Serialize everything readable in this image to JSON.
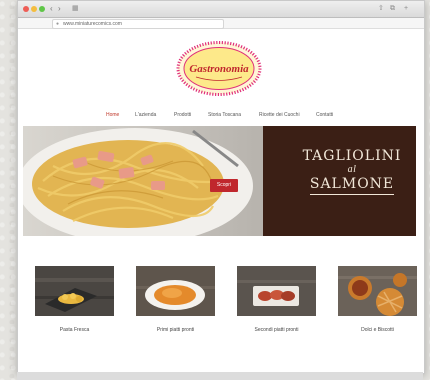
{
  "browser": {
    "url": "www.miniaturecomics.com",
    "back_icon": "chevron-left-icon",
    "forward_icon": "chevron-right-icon"
  },
  "site": {
    "logo_text": "Gastronomia",
    "menu": [
      "Home",
      "L'azienda",
      "Prodotti",
      "Storia Toscana",
      "Ricette dei Cuochi",
      "Contatti"
    ],
    "active_menu": "Home"
  },
  "hero": {
    "title_line1": "TAGLIOLINI",
    "title_line2": "al",
    "title_line3": "SALMONE",
    "button_label": "Scopri"
  },
  "products": [
    {
      "label": "Pasta Fresca"
    },
    {
      "label": "Primi piatti pronti"
    },
    {
      "label": "Secondi piatti pronti"
    },
    {
      "label": "Dolci e Biscotti"
    }
  ],
  "colors": {
    "accent": "#c0272d",
    "hero_bg": "#3b1f15",
    "logo_ring": "#e0307a"
  }
}
